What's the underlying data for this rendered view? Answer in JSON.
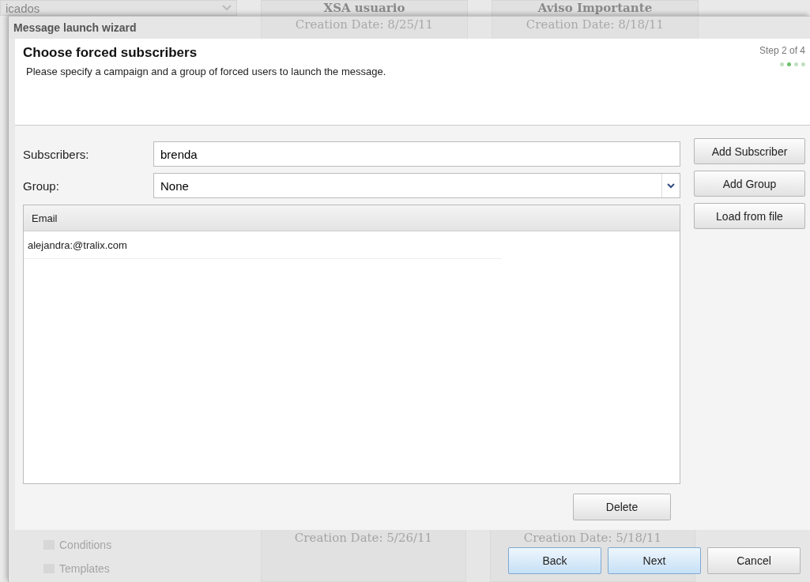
{
  "backdrop": {
    "top_dropdown": "icados",
    "cards_top": [
      {
        "title": "XSA usuario",
        "date": "Creation Date: 8/25/11"
      },
      {
        "title": "Aviso Importante",
        "date": "Creation Date: 8/18/11"
      }
    ],
    "sidebar_items": [
      "Conditions",
      "Templates"
    ],
    "cards_bottom": [
      {
        "date": "Creation Date: 5/26/11"
      },
      {
        "date": "Creation Date: 5/18/11"
      }
    ]
  },
  "window": {
    "title": "Message launch wizard"
  },
  "header": {
    "title": "Choose forced subscribers",
    "description": "Please specify a campaign and a group of forced users to launch the message.",
    "step": "Step 2 of 4",
    "steps": [
      {
        "selected": false
      },
      {
        "selected": true
      },
      {
        "selected": false
      },
      {
        "selected": false
      }
    ]
  },
  "form": {
    "subscribers_label": "Subscribers:",
    "subscribers_value": "brenda",
    "group_label": "Group:",
    "group_value": "None"
  },
  "side_buttons": [
    "Add Subscriber",
    "Add Group",
    "Load from file"
  ],
  "table": {
    "columns": [
      "Email"
    ],
    "rows": [
      [
        "alejandra:@tralix.com"
      ]
    ]
  },
  "delete_button": "Delete",
  "footer_buttons": [
    {
      "label": "Back",
      "highlighted": true
    },
    {
      "label": "Next",
      "highlighted": true
    },
    {
      "label": "Cancel",
      "highlighted": false
    }
  ]
}
